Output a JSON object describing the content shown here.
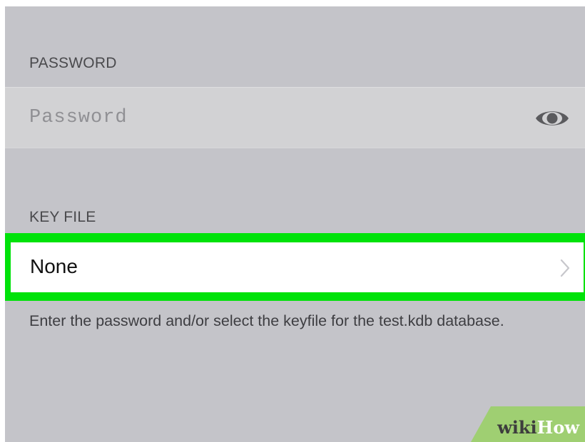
{
  "password_section": {
    "header": "PASSWORD",
    "placeholder": "Password",
    "value": ""
  },
  "keyfile_section": {
    "header": "KEY FILE",
    "value": "None"
  },
  "footer_note": "Enter the password and/or select the keyfile for the test.kdb database.",
  "watermark": {
    "part1": "wiki",
    "part2": "How"
  },
  "colors": {
    "background": "#c4c4c9",
    "highlight": "#00e20a",
    "field_background": "#d2d2d4",
    "row_background": "#ffffff"
  },
  "icons": [
    "eye-icon",
    "chevron-right-icon"
  ]
}
